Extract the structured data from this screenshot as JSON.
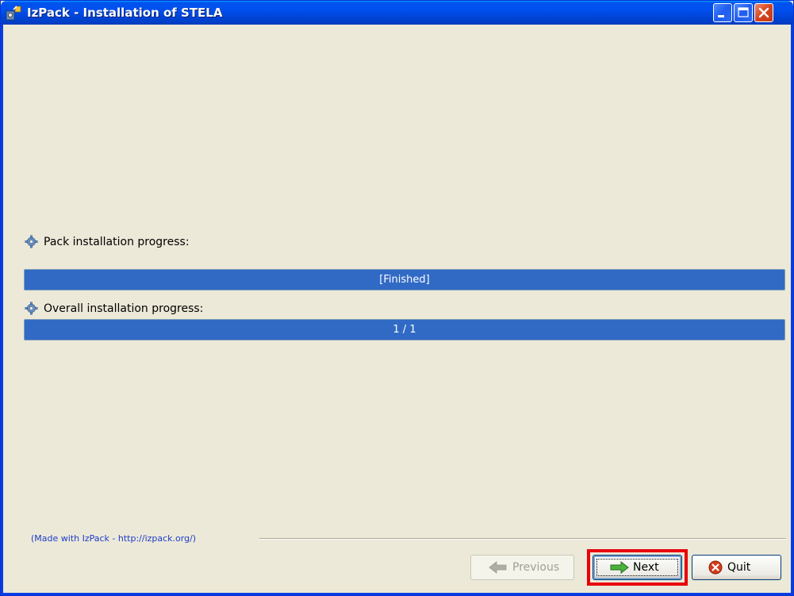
{
  "window": {
    "title": "IzPack - Installation of STELA"
  },
  "icons": {
    "app": "izpack-app-icon",
    "minimize": "minimize-icon",
    "maximize": "maximize-icon",
    "close": "close-icon",
    "progress": "gear-icon",
    "previous": "arrow-left-icon",
    "next": "arrow-right-icon",
    "quit": "quit-x-icon"
  },
  "pack_progress": {
    "label": "Pack installation progress:",
    "text": "[Finished]",
    "fraction": 1.0
  },
  "overall_progress": {
    "label": "Overall installation progress:",
    "text": "1 / 1",
    "fraction": 1.0
  },
  "footer": {
    "made_with": "(Made with IzPack - http://izpack.org/)"
  },
  "buttons": {
    "previous": "Previous",
    "next": "Next",
    "quit": "Quit"
  },
  "colors": {
    "titlebar": "#0050ee",
    "progress_fill": "#316ac5",
    "highlight": "#e8000b",
    "background": "#ece9d8"
  }
}
